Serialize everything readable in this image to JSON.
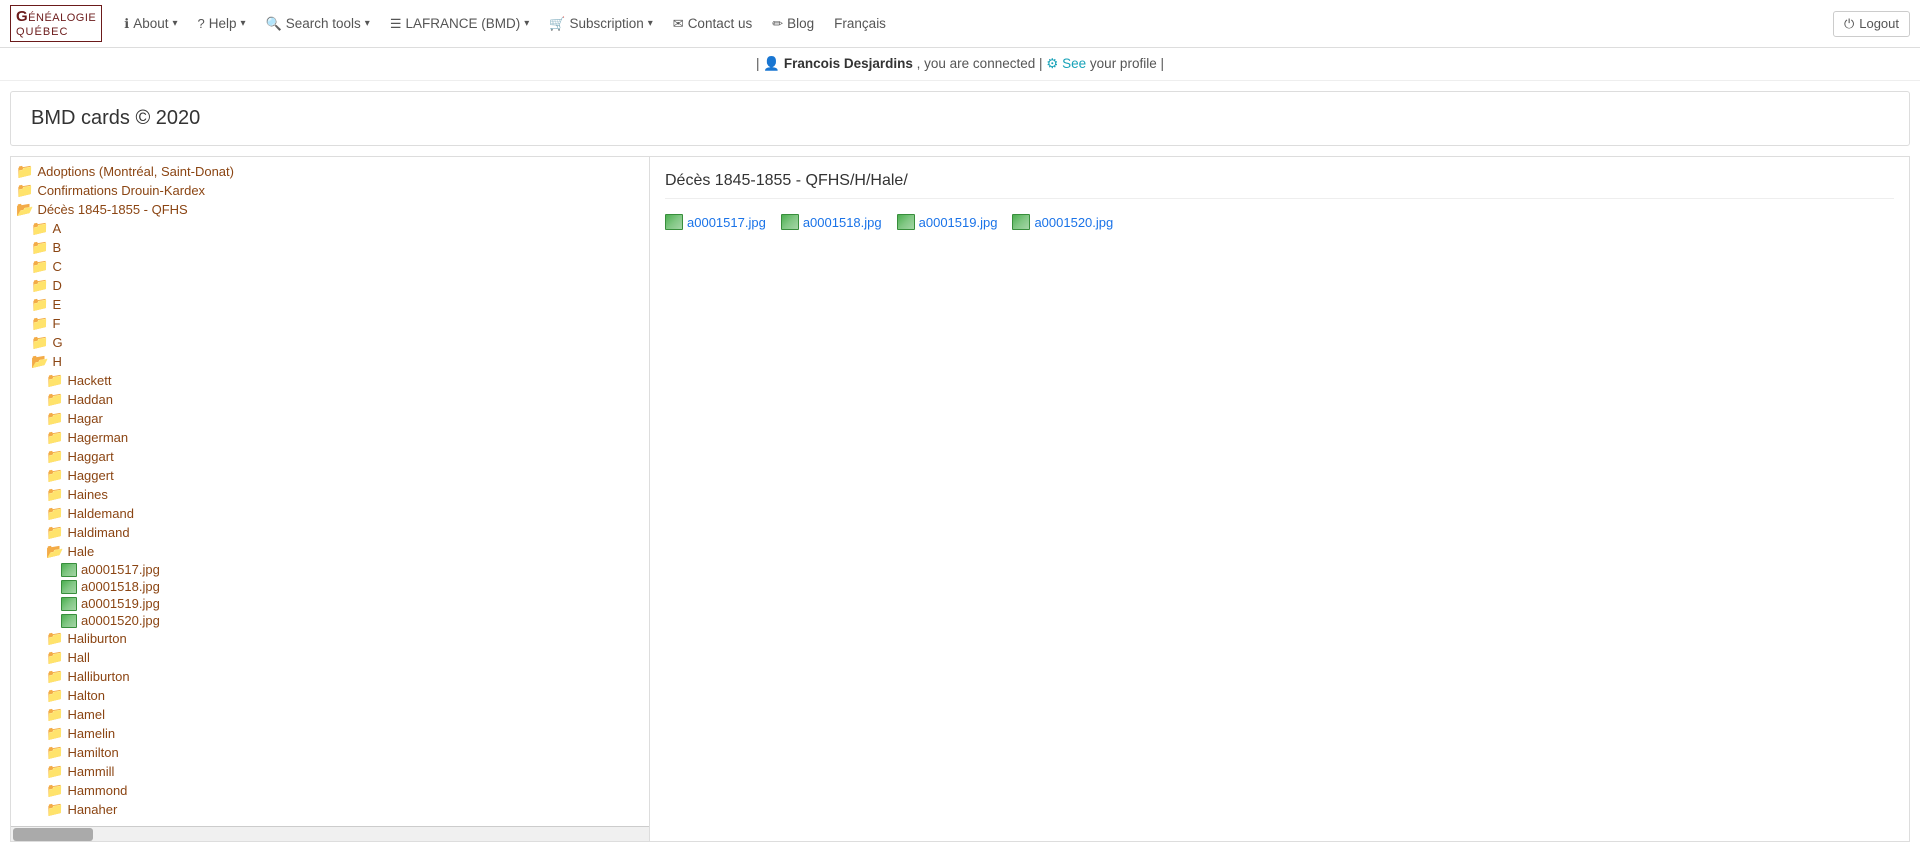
{
  "navbar": {
    "brand": {
      "line1": "Généalogie",
      "line2": "Québec"
    },
    "items": [
      {
        "id": "about",
        "label": "About",
        "icon": "ℹ",
        "hasDropdown": true
      },
      {
        "id": "help",
        "label": "Help",
        "icon": "?",
        "hasDropdown": true
      },
      {
        "id": "search-tools",
        "label": "Search tools",
        "icon": "🔍",
        "hasDropdown": true
      },
      {
        "id": "lafrance",
        "label": "LAFRANCE (BMD)",
        "icon": "≡",
        "hasDropdown": true
      },
      {
        "id": "subscription",
        "label": "Subscription",
        "icon": "🛒",
        "hasDropdown": true
      },
      {
        "id": "contact",
        "label": "Contact us",
        "icon": "✉",
        "hasDropdown": false
      },
      {
        "id": "blog",
        "label": "Blog",
        "icon": "📝",
        "hasDropdown": false
      },
      {
        "id": "francais",
        "label": "Français",
        "hasDropdown": false
      }
    ],
    "logout_label": "Logout",
    "logout_icon": "⏻"
  },
  "connected_bar": {
    "prefix": "| ",
    "user_icon": "👤",
    "username": "Francois Desjardins",
    "middle_text": ", you are connected |",
    "gear_icon": "⚙",
    "see_text": "See",
    "profile_text": "your profile",
    "suffix": " |"
  },
  "page_title": "BMD cards © 2020",
  "left_panel": {
    "tree": [
      {
        "level": 0,
        "type": "folder",
        "label": "Adoptions (Montréal, Saint-Donat)",
        "open": false
      },
      {
        "level": 0,
        "type": "folder",
        "label": "Confirmations Drouin-Kardex",
        "open": false
      },
      {
        "level": 0,
        "type": "folder",
        "label": "Décès 1845-1855 - QFHS",
        "open": true
      },
      {
        "level": 1,
        "type": "folder",
        "label": "A",
        "open": false
      },
      {
        "level": 1,
        "type": "folder",
        "label": "B",
        "open": false
      },
      {
        "level": 1,
        "type": "folder",
        "label": "C",
        "open": false
      },
      {
        "level": 1,
        "type": "folder",
        "label": "D",
        "open": false
      },
      {
        "level": 1,
        "type": "folder",
        "label": "E",
        "open": false
      },
      {
        "level": 1,
        "type": "folder",
        "label": "F",
        "open": false
      },
      {
        "level": 1,
        "type": "folder",
        "label": "G",
        "open": false
      },
      {
        "level": 1,
        "type": "folder",
        "label": "H",
        "open": true
      },
      {
        "level": 2,
        "type": "folder",
        "label": "Hackett",
        "open": false
      },
      {
        "level": 2,
        "type": "folder",
        "label": "Haddan",
        "open": false
      },
      {
        "level": 2,
        "type": "folder",
        "label": "Hagar",
        "open": false
      },
      {
        "level": 2,
        "type": "folder",
        "label": "Hagerman",
        "open": false
      },
      {
        "level": 2,
        "type": "folder",
        "label": "Haggart",
        "open": false
      },
      {
        "level": 2,
        "type": "folder",
        "label": "Haggert",
        "open": false
      },
      {
        "level": 2,
        "type": "folder",
        "label": "Haines",
        "open": false
      },
      {
        "level": 2,
        "type": "folder",
        "label": "Haldemand",
        "open": false
      },
      {
        "level": 2,
        "type": "folder",
        "label": "Haldimand",
        "open": false
      },
      {
        "level": 2,
        "type": "folder",
        "label": "Hale",
        "open": true
      },
      {
        "level": 3,
        "type": "file",
        "label": "a0001517.jpg"
      },
      {
        "level": 3,
        "type": "file",
        "label": "a0001518.jpg"
      },
      {
        "level": 3,
        "type": "file",
        "label": "a0001519.jpg"
      },
      {
        "level": 3,
        "type": "file",
        "label": "a0001520.jpg"
      },
      {
        "level": 2,
        "type": "folder",
        "label": "Haliburton",
        "open": false
      },
      {
        "level": 2,
        "type": "folder",
        "label": "Hall",
        "open": false
      },
      {
        "level": 2,
        "type": "folder",
        "label": "Halliburton",
        "open": false
      },
      {
        "level": 2,
        "type": "folder",
        "label": "Halton",
        "open": false
      },
      {
        "level": 2,
        "type": "folder",
        "label": "Hamel",
        "open": false
      },
      {
        "level": 2,
        "type": "folder",
        "label": "Hamelin",
        "open": false
      },
      {
        "level": 2,
        "type": "folder",
        "label": "Hamilton",
        "open": false
      },
      {
        "level": 2,
        "type": "folder",
        "label": "Hammill",
        "open": false
      },
      {
        "level": 2,
        "type": "folder",
        "label": "Hammond",
        "open": false
      },
      {
        "level": 2,
        "type": "folder",
        "label": "Hanaher",
        "open": false
      }
    ]
  },
  "right_panel": {
    "heading": "Décès 1845-1855 - QFHS/H/Hale/",
    "files": [
      {
        "label": "a0001517.jpg"
      },
      {
        "label": "a0001518.jpg"
      },
      {
        "label": "a0001519.jpg"
      },
      {
        "label": "a0001520.jpg"
      }
    ]
  }
}
